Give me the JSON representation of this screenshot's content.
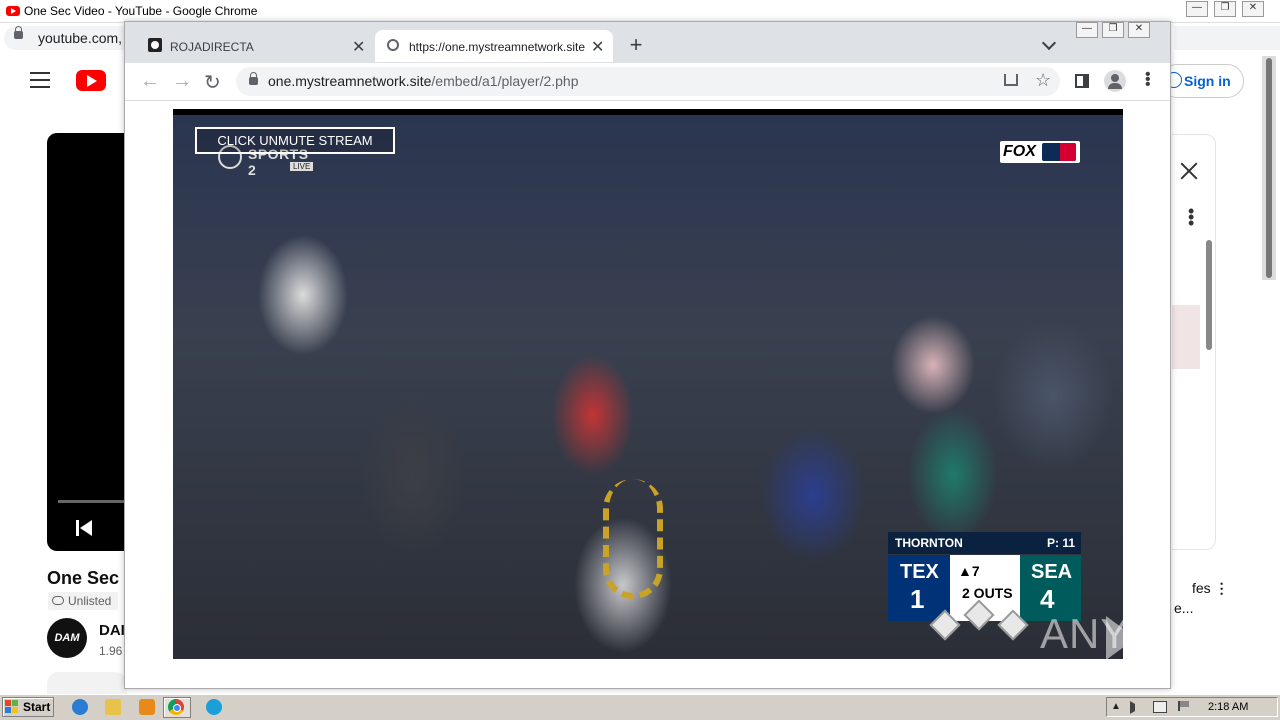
{
  "background_window": {
    "title": "One Sec Video - YouTube - Google Chrome",
    "omnibox_text": "youtube.com,",
    "controls": [
      "—",
      "❐",
      "✕"
    ],
    "youtube": {
      "sign_in_label": "Sign in",
      "video_title": "One Sec",
      "visibility_label": "Unlisted",
      "avatar_text": "DAM",
      "channel_name": "DAI",
      "subscriber_count": "1.96",
      "side_text_line1": "fes",
      "side_text_line2": "e..."
    }
  },
  "foreground_window": {
    "controls": [
      "—",
      "❐",
      "✕"
    ],
    "tabs": [
      {
        "label": "ROJADIRECTA",
        "close": "✕",
        "active": false
      },
      {
        "label": "https://one.mystreamnetwork.site/e",
        "close": "✕",
        "active": true
      }
    ],
    "new_tab_label": "+",
    "toolbar": {
      "back": "←",
      "forward": "→",
      "reload": "↻",
      "url_host": "one.mystreamnetwork.site",
      "url_path": "/embed/a1/player/2.php",
      "star": "☆",
      "kebab": "⋮"
    }
  },
  "player": {
    "unmute_label": "CLICK UNMUTE STREAM",
    "network_logo": "SPORTS 2",
    "live_badge": "LIVE",
    "broadcaster_logo": "FOX",
    "scorebug": {
      "pitcher": "THORNTON",
      "pitch_count": "P: 11",
      "away_team": "TEX",
      "away_score": "1",
      "inning": "▲7",
      "outs": "2 OUTS",
      "home_team": "SEA",
      "home_score": "4"
    },
    "watermark": "ANY RUN"
  },
  "taskbar": {
    "start_label": "Start",
    "tray_arrow": "≈",
    "clock": "2:18 AM"
  }
}
